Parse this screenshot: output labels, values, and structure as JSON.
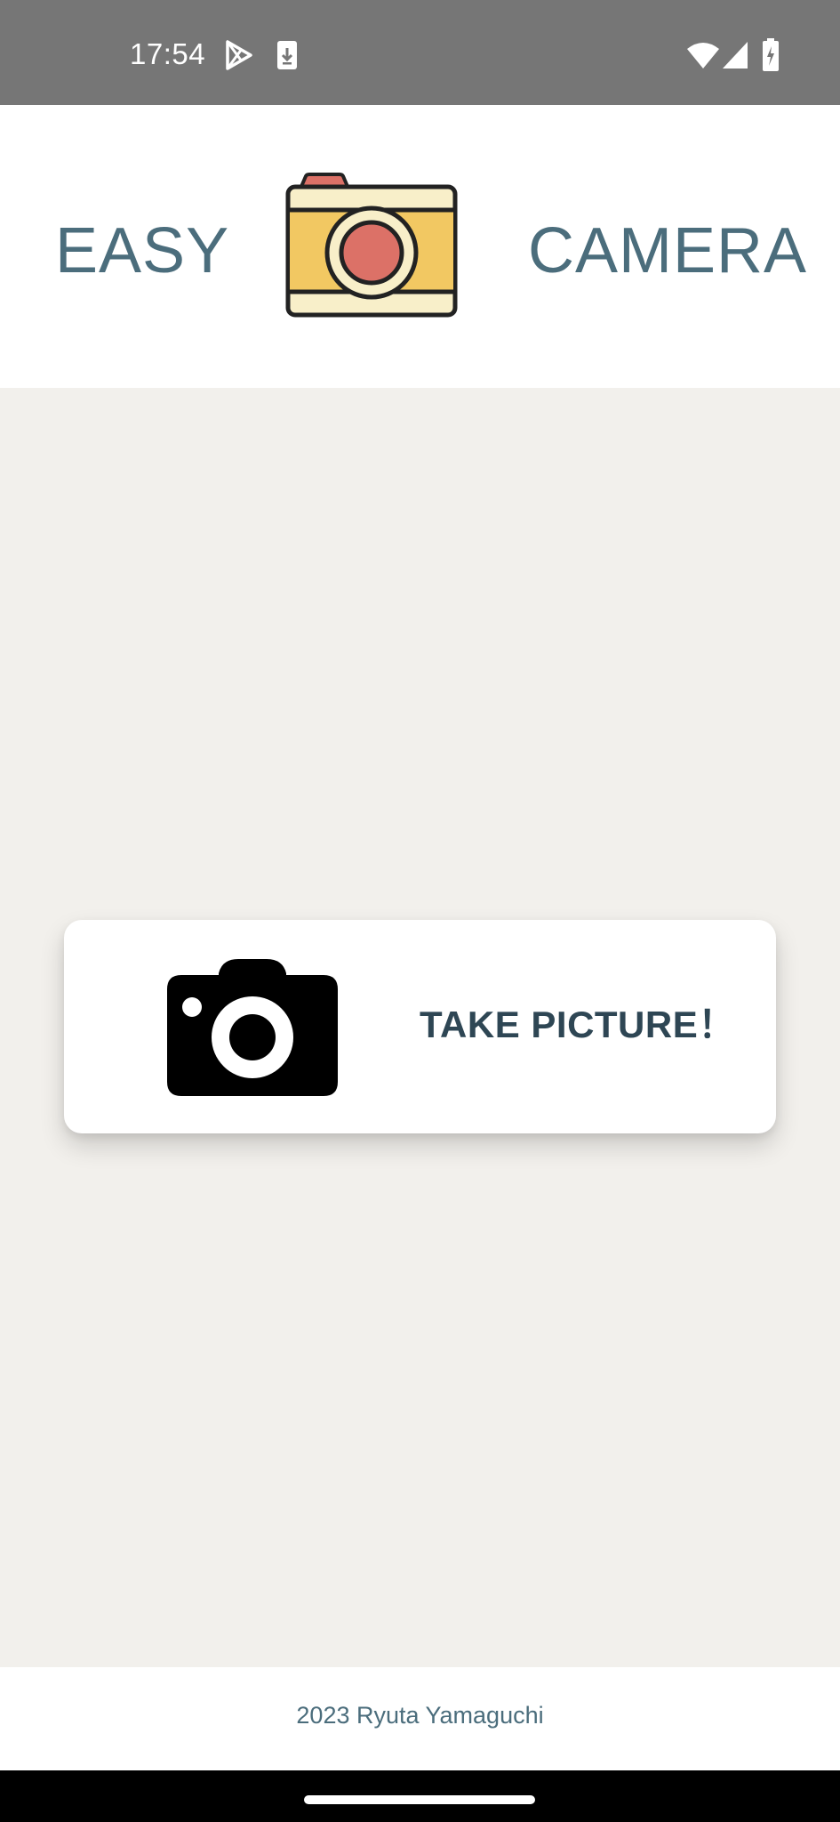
{
  "status_bar": {
    "time": "17:54",
    "left_icons": [
      "play-store-icon",
      "download-icon"
    ],
    "right_icons": [
      "wifi-icon",
      "cellular-signal-icon",
      "battery-charging-icon"
    ]
  },
  "header": {
    "left_word": "EASY",
    "right_word": "CAMERA",
    "logo_icon": "camera-logo-icon"
  },
  "main": {
    "take_picture_button": {
      "label": "TAKE PICTURE！",
      "icon": "camera-icon"
    }
  },
  "footer": {
    "text": "2023 Ryuta Yamaguchi"
  },
  "colors": {
    "status_bar": "#767676",
    "header_text": "#4b6d7c",
    "button_text": "#2e4654",
    "background": "#f2f0ec",
    "logo_body": "#f2c862",
    "logo_top": "#f8efc9",
    "logo_lens": "#dc7167"
  }
}
